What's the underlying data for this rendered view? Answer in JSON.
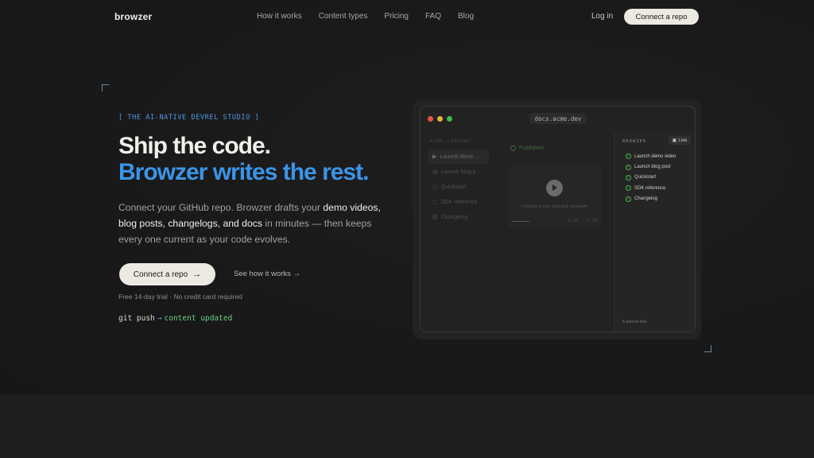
{
  "nav": {
    "logo": "browzer",
    "links": [
      "How it works",
      "Content types",
      "Pricing",
      "FAQ",
      "Blog"
    ],
    "login": "Log in",
    "cta": "Connect a repo"
  },
  "hero": {
    "eyebrow": "[ THE AI-NATIVE DEVREL STUDIO ]",
    "headline_1": "Ship the code.",
    "headline_2": "Browzer writes the rest.",
    "sub_1": "Connect your GitHub repo. Browzer drafts your ",
    "sub_bold": "demo videos, blog posts, changelogs, and docs",
    "sub_2": " in minutes — then keeps every one current as your code evolves.",
    "cta": "Connect a repo",
    "cta_arrow": "→",
    "secondary": "See how it works →",
    "trial": "Free 14-day trial · No credit card required",
    "git_cmd": "git push",
    "git_arrow": "→",
    "git_result": "content updated"
  },
  "mock": {
    "url": "docs.acme.dev",
    "sidebar_title": "ACME CONTENT",
    "sidebar_items": [
      {
        "icon": "▶",
        "label": "Launch demo ..."
      },
      {
        "icon": "▤",
        "label": "Launch blog p..."
      },
      {
        "icon": "▢",
        "label": "Quickstart"
      },
      {
        "icon": "▢",
        "label": "SDK reference"
      },
      {
        "icon": "▤",
        "label": "Changelog"
      }
    ],
    "published": "Published",
    "player_hint": "Connect a repo and click generate.",
    "time": "0:18 / 0:56",
    "panel_title": "BROWZER",
    "live": "Live",
    "panel_items": [
      "Launch demo video",
      "Launch blog post",
      "Quickstart",
      "SDK reference",
      "Changelog"
    ],
    "panel_foot": "5 pieces live"
  }
}
